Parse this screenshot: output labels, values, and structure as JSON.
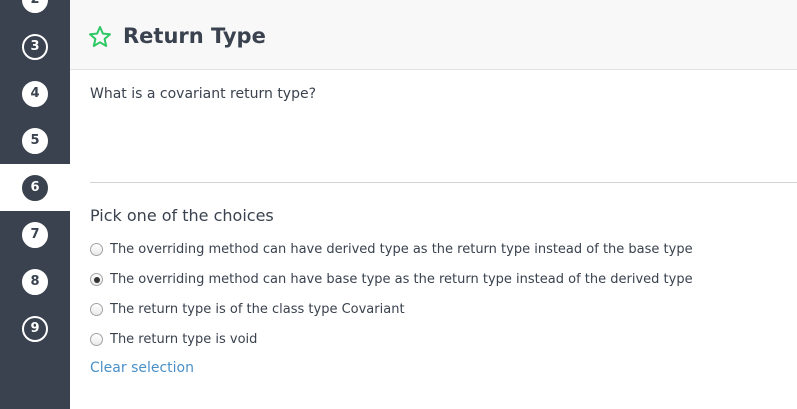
{
  "sidebar": {
    "items": [
      {
        "label": "2"
      },
      {
        "label": "3"
      },
      {
        "label": "4"
      },
      {
        "label": "5"
      },
      {
        "label": "6"
      },
      {
        "label": "7"
      },
      {
        "label": "8"
      },
      {
        "label": "9"
      }
    ],
    "active_item": "6"
  },
  "header": {
    "title": "Return Type",
    "star_icon": "star-outline-icon",
    "star_color": "#2ec866"
  },
  "question": {
    "text": "What is a covariant return type?"
  },
  "choices": {
    "heading": "Pick one of the choices",
    "options": [
      {
        "label": "The overriding method can have derived type as the return type instead of the base type",
        "selected": false
      },
      {
        "label": "The overriding method can have base type as the return type instead of the derived type",
        "selected": true
      },
      {
        "label": "The return type is of the class type Covariant",
        "selected": false
      },
      {
        "label": "The return type is void",
        "selected": false
      }
    ],
    "clear_label": "Clear selection"
  },
  "colors": {
    "sidebar_bg": "#39424e",
    "link": "#4a90c8",
    "text": "#39424e"
  }
}
